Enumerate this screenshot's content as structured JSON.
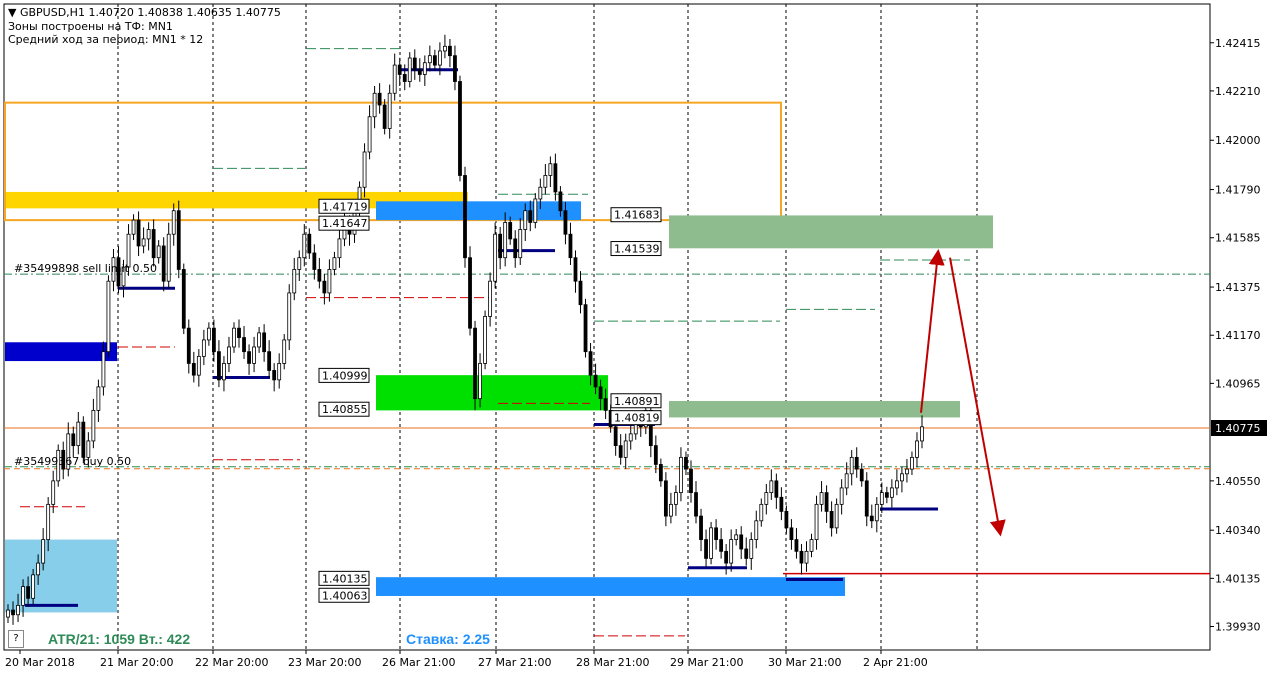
{
  "window": {
    "symbol_line": "GBPUSD,H1  1.40720 1.40838 1.40635 1.40775",
    "zones_line": "Зоны построены на ТФ: MN1",
    "avg_line": "Средний ход за период: MN1 * 12"
  },
  "info": {
    "atr_text": "ATR/21: 1059  Вт.: 422",
    "rate_text": "Ставка: 2.25",
    "help": "?"
  },
  "colors": {
    "up": "#000000",
    "down": "#000000",
    "price_line": "#e8711e",
    "yellow_zone": "#ffd500",
    "orange_box": "#f5a623",
    "blue_zone": "#1e90ff",
    "dark_blue_zone": "#0000cd",
    "light_blue_zone": "#87ceeb",
    "green_zone": "#00e000",
    "sage_zone": "#8fbc8f",
    "forecast_arrow": "#c00000"
  },
  "chart_data": {
    "type": "candlestick",
    "instrument": "GBPUSD",
    "timeframe": "H1",
    "current_price": 1.40775,
    "current_price_label": "1.40775",
    "ylim": [
      1.3983,
      1.4258
    ],
    "yticks": [
      "1.42415",
      "1.42210",
      "1.42000",
      "1.41790",
      "1.41585",
      "1.41375",
      "1.41170",
      "1.40965",
      "1.40550",
      "1.40340",
      "1.40135",
      "1.39930"
    ],
    "xticks": [
      "20 Mar 2018",
      "21 Mar 20:00",
      "22 Mar 20:00",
      "23 Mar 20:00",
      "26 Mar 21:00",
      "27 Mar 21:00",
      "28 Mar 21:00",
      "29 Mar 21:00",
      "30 Mar 21:00",
      "2 Apr 21:00"
    ],
    "level_labels": [
      {
        "text": "1.41719",
        "price": 1.41719
      },
      {
        "text": "1.41647",
        "price": 1.41647
      },
      {
        "text": "1.40999",
        "price": 1.40999
      },
      {
        "text": "1.40855",
        "price": 1.40855
      },
      {
        "text": "1.40135",
        "price": 1.40135
      },
      {
        "text": "1.40063",
        "price": 1.40063
      },
      {
        "text": "1.41683",
        "price": 1.41683
      },
      {
        "text": "1.41539",
        "price": 1.41539
      },
      {
        "text": "1.40891",
        "price": 1.40891
      },
      {
        "text": "1.40819",
        "price": 1.40819
      }
    ],
    "order_labels": [
      {
        "text": "#35499898 sell limit 0.50",
        "price": 1.4143
      },
      {
        "text": "#35499367 buy 0.50",
        "price": 1.4061
      }
    ],
    "zones": [
      {
        "name": "yellow",
        "from": 1.4178,
        "to": 1.4171
      },
      {
        "name": "orange-box",
        "from": 1.4216,
        "to": 1.4166
      },
      {
        "name": "blue-upper",
        "from": 1.4174,
        "to": 1.4166
      },
      {
        "name": "dark-blue",
        "from": 1.4114,
        "to": 1.4106
      },
      {
        "name": "light-blue",
        "from": 1.403,
        "to": 1.3999
      },
      {
        "name": "green",
        "from": 1.41,
        "to": 1.4085
      },
      {
        "name": "blue-lower",
        "from": 1.4014,
        "to": 1.4006
      },
      {
        "name": "sage-upper",
        "from": 1.4168,
        "to": 1.4154
      },
      {
        "name": "sage-lower",
        "from": 1.4089,
        "to": 1.4082
      }
    ],
    "closes": [
      1.4,
      1.3998,
      1.4002,
      1.401,
      1.4005,
      1.4015,
      1.402,
      1.403,
      1.4045,
      1.4055,
      1.4068,
      1.406,
      1.4075,
      1.407,
      1.408,
      1.4065,
      1.4072,
      1.4085,
      1.4095,
      1.411,
      1.414,
      1.415,
      1.4138,
      1.4146,
      1.416,
      1.4166,
      1.4155,
      1.4158,
      1.4162,
      1.415,
      1.4155,
      1.414,
      1.416,
      1.417,
      1.4145,
      1.412,
      1.4105,
      1.41,
      1.4108,
      1.4115,
      1.412,
      1.411,
      1.4098,
      1.4105,
      1.4112,
      1.412,
      1.4116,
      1.411,
      1.4105,
      1.4112,
      1.4118,
      1.411,
      1.4102,
      1.4098,
      1.4105,
      1.4115,
      1.4135,
      1.4145,
      1.415,
      1.416,
      1.4152,
      1.4145,
      1.414,
      1.4135,
      1.4145,
      1.415,
      1.4158,
      1.4165,
      1.416,
      1.417,
      1.418,
      1.4195,
      1.421,
      1.422,
      1.4215,
      1.4205,
      1.422,
      1.4232,
      1.4228,
      1.4225,
      1.4235,
      1.423,
      1.4228,
      1.4233,
      1.4236,
      1.4232,
      1.4238,
      1.424,
      1.4236,
      1.4225,
      1.4185,
      1.415,
      1.412,
      1.409,
      1.4105,
      1.4125,
      1.414,
      1.416,
      1.415,
      1.4165,
      1.4158,
      1.415,
      1.4162,
      1.417,
      1.4165,
      1.4175,
      1.418,
      1.4185,
      1.419,
      1.4178,
      1.417,
      1.416,
      1.415,
      1.414,
      1.413,
      1.411,
      1.41,
      1.4095,
      1.409,
      1.4085,
      1.4078,
      1.407,
      1.4065,
      1.4072,
      1.4075,
      1.408,
      1.4078,
      1.4085,
      1.407,
      1.4062,
      1.4055,
      1.404,
      1.4045,
      1.405,
      1.4065,
      1.406,
      1.405,
      1.404,
      1.403,
      1.4022,
      1.4035,
      1.403,
      1.4025,
      1.402,
      1.403,
      1.4032,
      1.4026,
      1.4022,
      1.403,
      1.4038,
      1.4045,
      1.405,
      1.4055,
      1.4048,
      1.4042,
      1.4035,
      1.403,
      1.4025,
      1.402,
      1.4025,
      1.403,
      1.4045,
      1.405,
      1.4042,
      1.4035,
      1.4045,
      1.4052,
      1.4058,
      1.4065,
      1.406,
      1.4055,
      1.404,
      1.4038,
      1.4045,
      1.405,
      1.4048,
      1.4052,
      1.4055,
      1.4058,
      1.406,
      1.4065,
      1.4072,
      1.4078
    ]
  }
}
